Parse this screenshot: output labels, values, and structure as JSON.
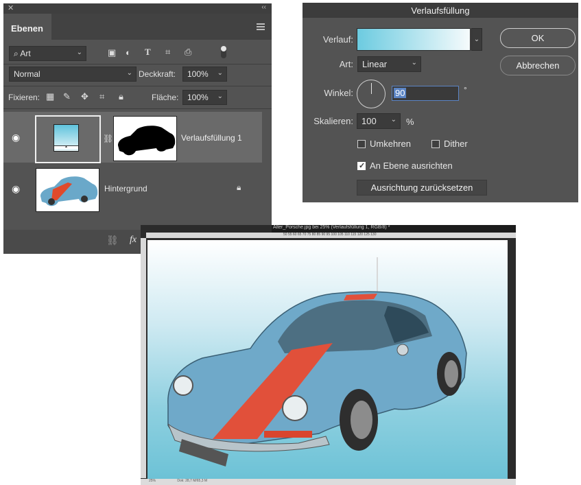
{
  "layers_panel": {
    "close_glyph": "✕",
    "collapse_glyph": "‹‹",
    "tab_label": "Ebenen",
    "filter_label": "Art",
    "blend_mode": "Normal",
    "opacity_label": "Deckkraft:",
    "opacity_value": "100%",
    "lock_label": "Fixieren:",
    "fill_label": "Fläche:",
    "fill_value": "100%",
    "layers": [
      {
        "name": "Verlaufsfüllung 1",
        "selected": true
      },
      {
        "name": "Hintergrund",
        "selected": false
      }
    ],
    "bottom_icons": [
      "link-icon",
      "fx-icon",
      "mask-icon",
      "adjustment-icon",
      "folder-icon",
      "new-layer-icon",
      "trash-icon"
    ]
  },
  "gradient_dialog": {
    "title": "Verlaufsfüllung",
    "gradient_label": "Verlauf:",
    "gradient_colors": [
      "#6ccbe0",
      "#f6fbfc"
    ],
    "style_label": "Art:",
    "style_value": "Linear",
    "angle_label": "Winkel:",
    "angle_value": "90",
    "angle_unit": "°",
    "scale_label": "Skalieren:",
    "scale_value": "100",
    "scale_unit": "%",
    "reverse_label": "Umkehren",
    "reverse_checked": false,
    "dither_label": "Dither",
    "dither_checked": false,
    "align_label": "An Ebene ausrichten",
    "align_checked": true,
    "reset_label": "Ausrichtung zurücksetzen",
    "ok_label": "OK",
    "cancel_label": "Abbrechen"
  },
  "document": {
    "tab_title": "Alter_Porsche.jpg bei 25% (Verlaufsfüllung 1, RGB/8) *",
    "ruler_ticks": "50    55    60    65    70    75    80    85    90    95    100    105    110    115    120    125    130",
    "status_zoom": "25%",
    "status_doc": "Dok: 28,7 M/65,3 M"
  }
}
